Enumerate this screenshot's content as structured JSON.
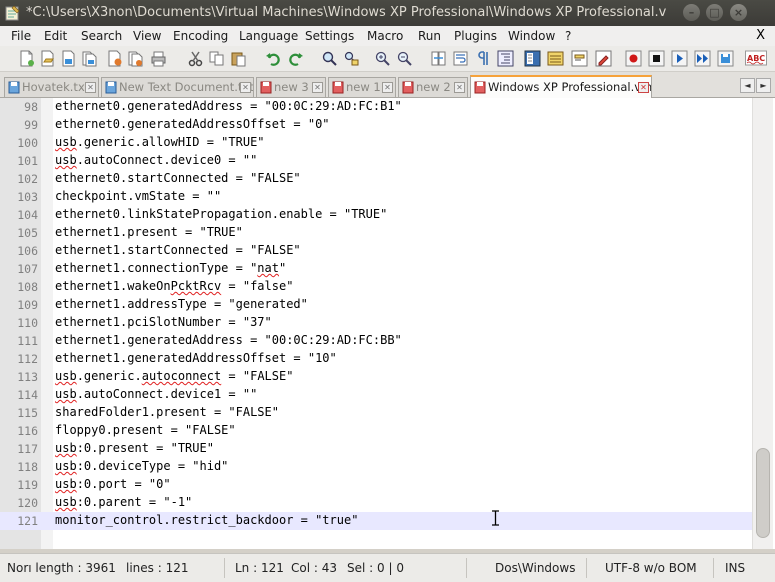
{
  "window": {
    "title": "*C:\\Users\\X3non\\Documents\\Virtual Machines\\Windows XP Professional\\Windows XP Professional.vm",
    "minimize_label": "–",
    "maximize_label": "□",
    "close_label": "×"
  },
  "menu": {
    "items": [
      "File",
      "Edit",
      "Search",
      "View",
      "Encoding",
      "Language",
      "Settings",
      "Macro",
      "Run",
      "Plugins",
      "Window",
      "?"
    ],
    "close_label": "X"
  },
  "toolbar": {
    "buttons": [
      "new-file",
      "open-file",
      "save",
      "save-all",
      "close",
      "close-all",
      "print",
      "cut",
      "copy",
      "paste",
      "undo",
      "redo",
      "find",
      "replace",
      "zoom-in",
      "zoom-out",
      "sync-vertical",
      "word-wrap",
      "show-all-chars",
      "indent-guide",
      "doc-map",
      "function-list",
      "folder-workspace",
      "record-macro",
      "stop-macro",
      "play-macro",
      "run-macro-multiple",
      "save-macro",
      "spell-check"
    ],
    "spell_check_label": "ABC"
  },
  "tabs": [
    {
      "label": "Hovatek.txt",
      "active": false
    },
    {
      "label": "New Text Document.txt",
      "active": false
    },
    {
      "label": "new  3",
      "active": false
    },
    {
      "label": "new  1",
      "active": false
    },
    {
      "label": "new  2",
      "active": false
    },
    {
      "label": "Windows XP Professional.vmx",
      "active": true
    }
  ],
  "tab_nav": {
    "prev": "◄",
    "next": "►"
  },
  "editor": {
    "lines": [
      {
        "n": "98",
        "text": "ethernet0.generatedAddress = \"00:0C:29:AD:FC:B1\""
      },
      {
        "n": "99",
        "text": "ethernet0.generatedAddressOffset = \"0\""
      },
      {
        "n": "100",
        "text": "usb.generic.allowHID = \"TRUE\""
      },
      {
        "n": "101",
        "text": "usb.autoConnect.device0 = \"\""
      },
      {
        "n": "102",
        "text": "ethernet0.startConnected = \"FALSE\""
      },
      {
        "n": "103",
        "text": "checkpoint.vmState = \"\""
      },
      {
        "n": "104",
        "text": "ethernet0.linkStatePropagation.enable = \"TRUE\""
      },
      {
        "n": "105",
        "text": "ethernet1.present = \"TRUE\""
      },
      {
        "n": "106",
        "text": "ethernet1.startConnected = \"FALSE\""
      },
      {
        "n": "107",
        "text": "ethernet1.connectionType = \"nat\""
      },
      {
        "n": "108",
        "text": "ethernet1.wakeOnPcktRcv = \"false\""
      },
      {
        "n": "109",
        "text": "ethernet1.addressType = \"generated\""
      },
      {
        "n": "110",
        "text": "ethernet1.pciSlotNumber = \"37\""
      },
      {
        "n": "111",
        "text": "ethernet1.generatedAddress = \"00:0C:29:AD:FC:BB\""
      },
      {
        "n": "112",
        "text": "ethernet1.generatedAddressOffset = \"10\""
      },
      {
        "n": "113",
        "text": "usb.generic.autoconnect = \"FALSE\""
      },
      {
        "n": "114",
        "text": "usb.autoConnect.device1 = \"\""
      },
      {
        "n": "115",
        "text": "sharedFolder1.present = \"FALSE\""
      },
      {
        "n": "116",
        "text": "floppy0.present = \"FALSE\""
      },
      {
        "n": "117",
        "text": "usb:0.present = \"TRUE\""
      },
      {
        "n": "118",
        "text": "usb:0.deviceType = \"hid\""
      },
      {
        "n": "119",
        "text": "usb:0.port = \"0\""
      },
      {
        "n": "120",
        "text": "usb:0.parent = \"-1\""
      },
      {
        "n": "121",
        "text": "monitor_control.restrict_backdoor = \"true\""
      }
    ],
    "current_line": "121",
    "current_line_color": "#e8e8ff"
  },
  "status": {
    "length": "Norı length : 3961",
    "lines": "lines : 121",
    "ln": "Ln : 121",
    "col": "Col : 43",
    "sel": "Sel : 0 | 0",
    "eol": "Dos\\Windows",
    "encoding": "UTF-8 w/o BOM",
    "mode": "INS"
  },
  "colors": {
    "active_tab_accent": "#f6a23a",
    "title_bar": "#3c3b37",
    "spell_underline": "#e02020"
  }
}
